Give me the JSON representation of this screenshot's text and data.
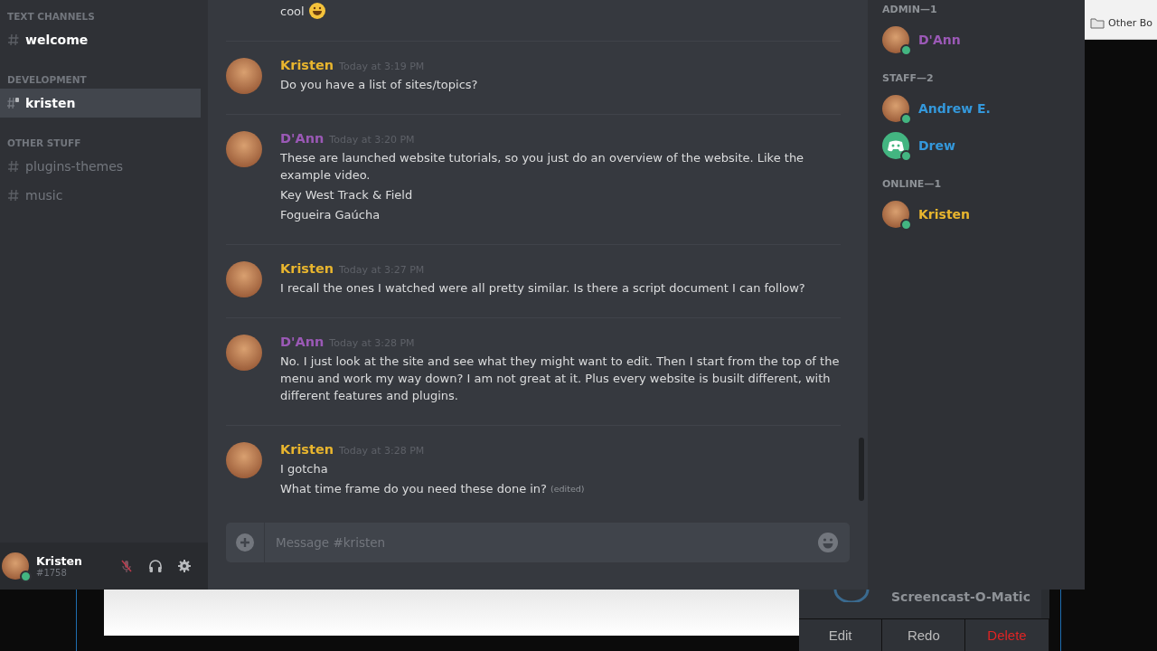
{
  "sidebar": {
    "categories": [
      {
        "name": "TEXT CHANNELS",
        "channels": [
          {
            "name": "welcome",
            "kind": "text",
            "selected": false
          }
        ]
      },
      {
        "name": "DEVELOPMENT",
        "channels": [
          {
            "name": "kristen",
            "kind": "private",
            "selected": true
          }
        ]
      },
      {
        "name": "OTHER STUFF",
        "channels": [
          {
            "name": "plugins-themes",
            "kind": "text",
            "selected": false
          },
          {
            "name": "music",
            "kind": "text",
            "selected": false
          }
        ]
      }
    ]
  },
  "user_panel": {
    "name": "Kristen",
    "tag": "#1758",
    "online": true,
    "muted": true
  },
  "messages": [
    {
      "lines": [
        {
          "text": "cool",
          "emoji": true
        }
      ]
    },
    {
      "author": "Kristen",
      "color": "#e8b52e",
      "time": "Today at 3:19 PM",
      "lines": [
        {
          "text": "Do you have a list of sites/topics?"
        }
      ]
    },
    {
      "author": "D'Ann",
      "color": "#9b59b6",
      "time": "Today at 3:20 PM",
      "lines": [
        {
          "text": "These are launched website tutorials, so  you just do an overview of the website. Like the example video."
        },
        {
          "text": "Key West Track & Field"
        },
        {
          "text": "Fogueira Gaúcha"
        }
      ]
    },
    {
      "author": "Kristen",
      "color": "#e8b52e",
      "time": "Today at 3:27 PM",
      "lines": [
        {
          "text": "I recall the ones I watched were all pretty similar. Is there a script document I can follow?"
        }
      ]
    },
    {
      "author": "D'Ann",
      "color": "#9b59b6",
      "time": "Today at 3:28 PM",
      "lines": [
        {
          "text": "No. I just look at the site and see what they might want to edit. Then I start from the top of the menu and work my way down? I  am not great at it.  Plus every website is busilt different, with different features and plugins."
        }
      ]
    },
    {
      "author": "Kristen",
      "color": "#e8b52e",
      "time": "Today at 3:28 PM",
      "lines": [
        {
          "text": "I gotcha"
        },
        {
          "text": "What time frame do you need these done in?",
          "edited": "(edited)"
        }
      ]
    }
  ],
  "composer": {
    "placeholder": "Message #kristen"
  },
  "members": [
    {
      "title": "ADMIN—1",
      "members": [
        {
          "name": "D'Ann",
          "color": "#9b59b6",
          "kind": "photo",
          "online": true
        }
      ]
    },
    {
      "title": "STAFF—2",
      "members": [
        {
          "name": "Andrew E.",
          "color": "#3498db",
          "kind": "photo",
          "online": true
        },
        {
          "name": "Drew",
          "color": "#3498db",
          "kind": "default",
          "online": true
        }
      ]
    },
    {
      "title": "ONLINE—1",
      "members": [
        {
          "name": "Kristen",
          "color": "#e8b52e",
          "kind": "photo",
          "online": true
        }
      ]
    }
  ],
  "browser": {
    "bookmark": "Other Bo"
  },
  "recorder": {
    "title": "Screencast-O-Matic",
    "buttons": [
      {
        "label": "Edit",
        "kind": "normal"
      },
      {
        "label": "Redo",
        "kind": "normal"
      },
      {
        "label": "Delete",
        "kind": "danger"
      }
    ]
  }
}
